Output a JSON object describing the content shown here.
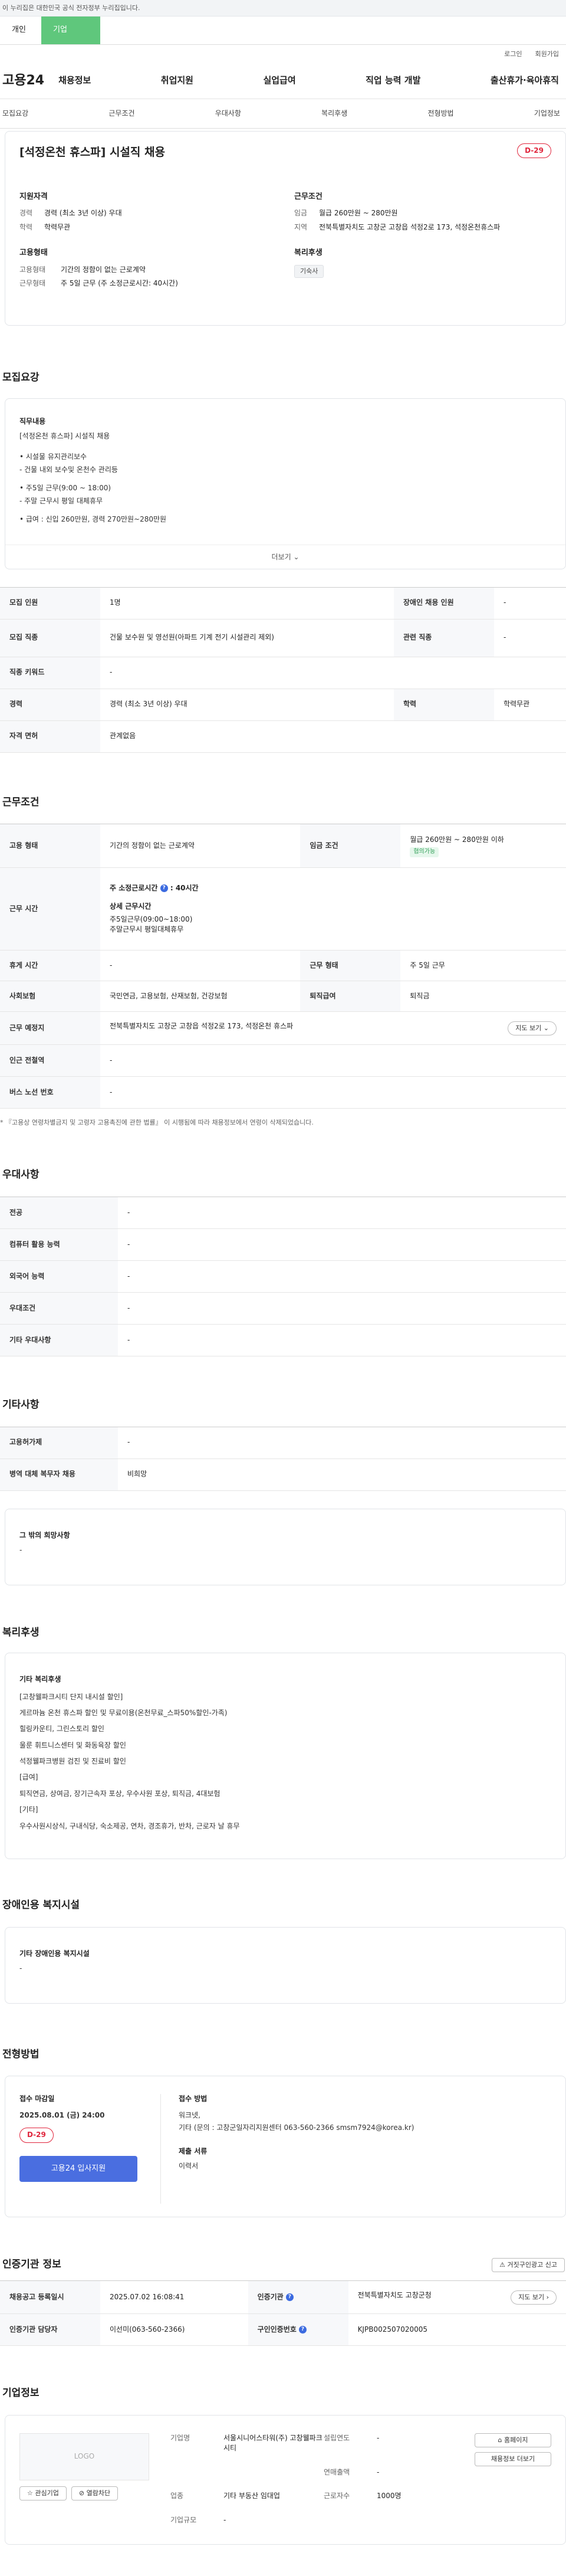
{
  "gov_bar": {
    "text": "이 누리집은 대한민국 공식 전자정부 누리집입니다."
  },
  "top_tabs": [
    "개인",
    "기업"
  ],
  "util": [
    "로그인",
    "회원가입"
  ],
  "logo": "고용24",
  "gnb": [
    "채용정보",
    "취업지원",
    "실업급여",
    "직업 능력 개발",
    "출산휴가·육아휴직"
  ],
  "subnav": [
    "모집요강",
    "근무조건",
    "우대사항",
    "복리후생",
    "전형방법",
    "기업정보"
  ],
  "hero": {
    "title": "[석정온천 휴스파] 시설직 채용",
    "dday": "D-29",
    "qual": {
      "title": "지원자격",
      "career_k": "경력",
      "career_v": "경력 (최소 3년 이상) 우대",
      "edu_k": "학력",
      "edu_v": "학력무관"
    },
    "work": {
      "title": "근무조건",
      "wage_k": "임금",
      "wage_v": "월급 260만원 ~ 280만원",
      "loc_k": "지역",
      "loc_v": "전북특별자치도 고창군 고창읍 석정2로 173, 석정온천휴스파"
    },
    "emp": {
      "title": "고용형태",
      "type_k": "고용형태",
      "type_v": "기간의 정함이 없는 근로계약",
      "form_k": "근무형태",
      "form_v": "주 5일 근무 (주 소정근로시간: 40시간)"
    },
    "welfare": {
      "title": "복리후생",
      "chip": "기숙사"
    }
  },
  "recruit": {
    "title": "모집요강",
    "job_heading": "직무내용",
    "job_lines": [
      "[석정온천 휴스파] 시설직 채용",
      "• 시설물 유지관리보수",
      "- 건물 내외 보수및 온천수 관리등",
      "• 주5일 근무(9:00 ~ 18:00)",
      "- 주말 근무시 평일 대체휴무",
      "• 급여 : 신입 260만원, 경력 270만원~280만원"
    ],
    "more": "더보기",
    "rows": {
      "count_k": "모집 인원",
      "count_v": "1명",
      "disabled_k": "장애인 채용 인원",
      "disabled_v": "-",
      "job_k": "모집 직종",
      "job_v": "건물 보수원 및 영선원(아파트 기계 전기 시설관리 제외)",
      "related_k": "관련 직종",
      "related_v": "-",
      "keyword_k": "직종 키워드",
      "keyword_v": "-",
      "career_k": "경력",
      "career_v": "경력 (최소 3년 이상) 우대",
      "edu_k": "학력",
      "edu_v": "학력무관",
      "license_k": "자격 면허",
      "license_v": "관계없음"
    }
  },
  "conditions": {
    "title": "근무조건",
    "emp_k": "고용 형태",
    "emp_v": "기간의 정함이 없는 근로계약",
    "wage_k": "임금 조건",
    "wage_v": "월급 260만원 ~ 280만원 이하",
    "wage_tag": "협의가능",
    "time_k": "근무 시간",
    "time_main": "주 소정근로시간",
    "time_hours": ": 40시간",
    "time_detail_h": "상세 근무시간",
    "time_detail_1": "주5일근무(09:00~18:00)",
    "time_detail_2": "주말근무시 평일대체휴무",
    "rest_k": "휴게 시간",
    "rest_v": "-",
    "form_k": "근무 형태",
    "form_v": "주 5일 근무",
    "ins_k": "사회보험",
    "ins_v": "국민연금, 고용보험, 산재보험, 건강보험",
    "retire_k": "퇴직급여",
    "retire_v": "퇴직금",
    "place_k": "근무 예정지",
    "place_v": "전북특별자치도 고창군 고창읍 석정2로 173, 석정온천 휴스파",
    "map_btn": "지도 보기",
    "subway_k": "인근 전철역",
    "subway_v": "-",
    "bus_k": "버스 노선 번호",
    "bus_v": "-",
    "note": "* 『고용상 연령차별금지 및 고령자 고용촉진에 관한 법률』 이 시행됨에 따라 채용정보에서 연령이 삭제되었습니다."
  },
  "prefer": {
    "title": "우대사항",
    "rows": [
      [
        "전공",
        "-"
      ],
      [
        "컴퓨터 활용 능력",
        "-"
      ],
      [
        "외국어 능력",
        "-"
      ],
      [
        "우대조건",
        "-"
      ],
      [
        "기타 우대사항",
        "-"
      ]
    ]
  },
  "etc": {
    "title": "기타사항",
    "rows": [
      [
        "고용허가제",
        "-"
      ],
      [
        "병역 대체 복무자 채용",
        "비희망"
      ]
    ],
    "wish_title": "그 밖의 희망사항",
    "wish_v": "-"
  },
  "welfare": {
    "title": "복리후생",
    "heading": "기타 복리후생",
    "lines": [
      "[고창웰파크시티 단지 내시설 할인]",
      "게르마늄 온천 휴스파 할인 및 무료이용(온천무료_스파50%할인-가족)",
      "힐링카운티, 그린스토리 할인",
      "울룬 휘트니스센터 및 화동육장 할인",
      "석정웰파크병원 검진 및 진료비 할인",
      "[급여]",
      "퇴직연금, 상여금, 장기근속자 포상, 우수사원 포상, 퇴직금, 4대보험",
      "[기타]",
      "우수사원시상식, 구내식당, 숙소제공, 연차, 경조휴가, 반차, 근로자 날 휴무"
    ]
  },
  "disabled": {
    "title": "장애인용 복지시설",
    "heading": "기타 장애인용 복지시설",
    "v": "-"
  },
  "process": {
    "title": "전형방법",
    "deadline_h": "접수 마감일",
    "deadline_v": "2025.08.01 (금) 24:00",
    "dday": "D-29",
    "apply_btn": "고용24 입사지원",
    "method_h": "접수 방법",
    "method_1": "워크넷,",
    "method_2": "기타 (문의 : 고창군일자리지원센터 063-560-2366 smsm7924@korea.kr)",
    "doc_h": "제출 서류",
    "doc_v": "이력서"
  },
  "agency": {
    "title": "인증기관 정보",
    "report_btn": "거짓구인광고 신고",
    "reg_k": "채용공고 등록일시",
    "reg_v": "2025.07.02 16:08:41",
    "inst_k": "인증기관",
    "inst_v": "전북특별자치도 고창군청",
    "map_btn": "지도 보기",
    "mgr_k": "인증기관 담당자",
    "mgr_v": "이선미(063-560-2366)",
    "no_k": "구인인증번호",
    "no_v": "KJPB002507020005"
  },
  "company": {
    "title": "기업정보",
    "logo_text": "LOGO",
    "fav_btn": "관심기업",
    "block_btn": "열람차단",
    "name_k": "기업명",
    "name_v": "서울시니어스타워(주) 고창웰파크시티",
    "found_k": "설립연도",
    "found_v": "-",
    "sales_k": "연매출액",
    "sales_v": "-",
    "ind_k": "업종",
    "ind_v": "기타 부동산 임대업",
    "emp_k": "근로자수",
    "emp_v": "1000명",
    "size_k": "기업규모",
    "size_v": "-",
    "home_btn": "홈페이지",
    "jobs_btn": "채용정보 더보기"
  }
}
